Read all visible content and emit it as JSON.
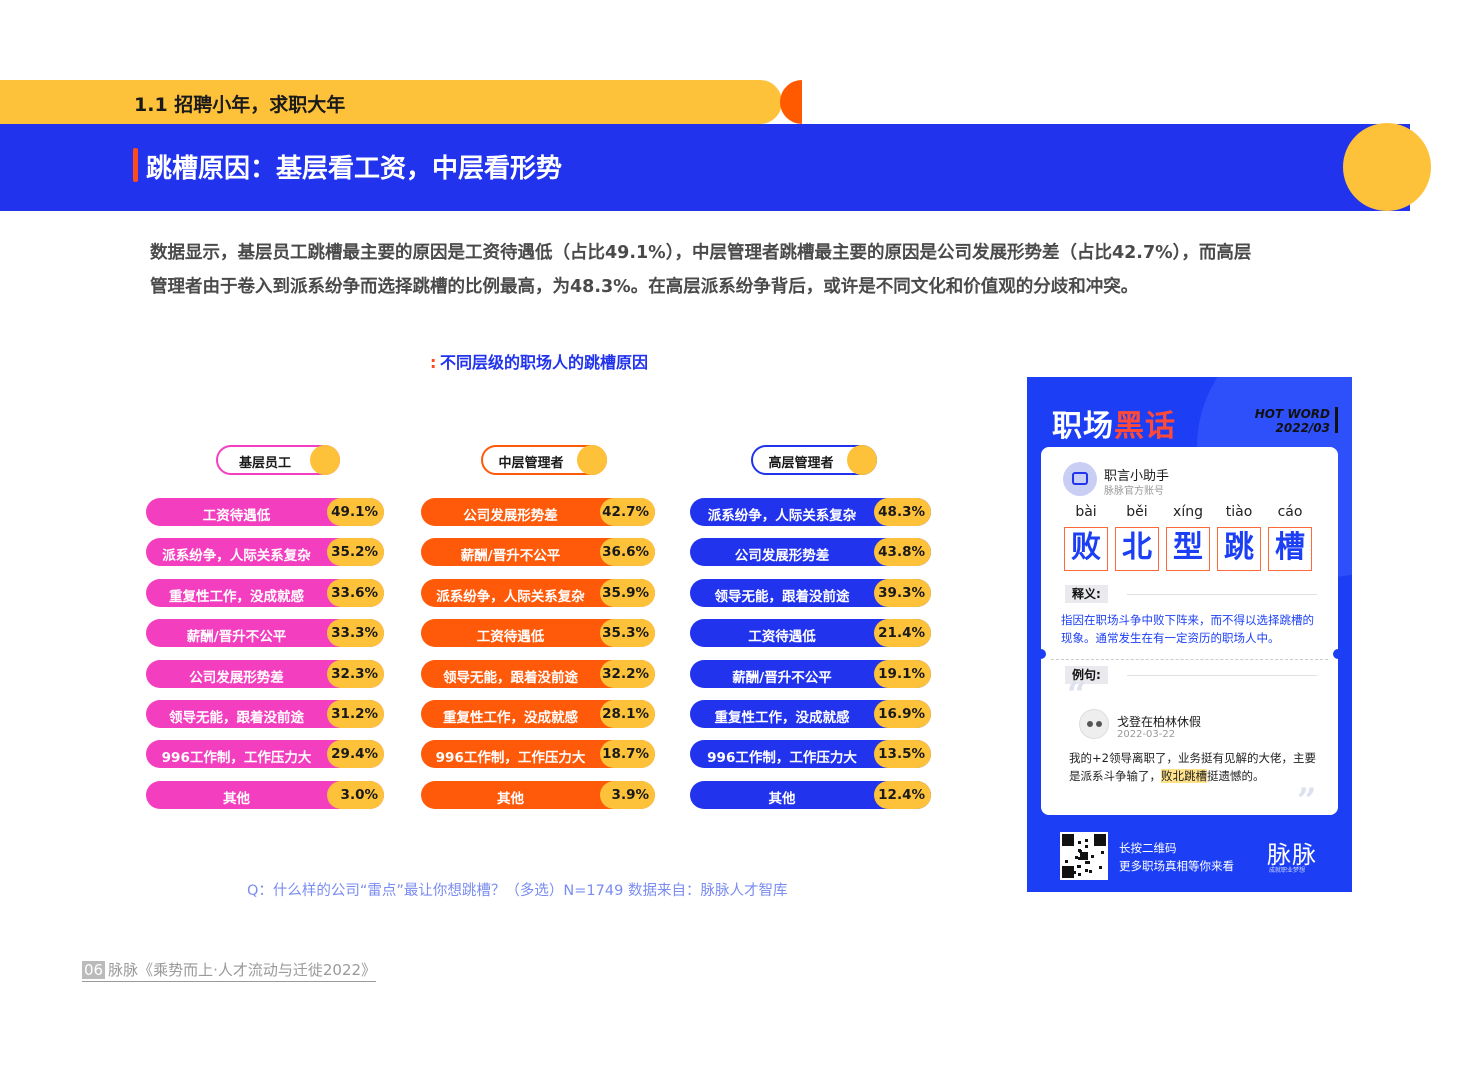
{
  "header": {
    "section": "1.1 招聘小年，求职大年",
    "title": "跳槽原因：基层看工资，中层看形势"
  },
  "intro": {
    "line1": "数据显示，基层员工跳槽最主要的原因是工资待遇低（占比49.1%），中层管理者跳槽最主要的原因是公司发展形势差（占比42.7%），而高层",
    "line2": "管理者由于卷入到派系纷争而选择跳槽的比例最高，为48.3%。在高层派系纷争背后，或许是不同文化和价值观的分歧和冲突。"
  },
  "chart_title": "不同层级的职场人的跳槽原因",
  "colors": {
    "pink": "#F43EC0",
    "orange": "#FF5A0A",
    "blue": "#2233EE",
    "yellow": "#FDC23A"
  },
  "chart_data": [
    {
      "type": "bar",
      "title": "基层员工",
      "categories": [
        "工资待遇低",
        "派系纷争，人际关系复杂",
        "重复性工作，没成就感",
        "薪酬/晋升不公平",
        "公司发展形势差",
        "领导无能，跟着没前途",
        "996工作制，工作压力大",
        "其他"
      ],
      "values": [
        49.1,
        35.2,
        33.6,
        33.3,
        32.3,
        31.2,
        29.4,
        3.0
      ],
      "value_labels": [
        "49.1%",
        "35.2%",
        "33.6%",
        "33.3%",
        "32.3%",
        "31.2%",
        "29.4%",
        "3.0%"
      ],
      "color": "#F43EC0",
      "unit": "%"
    },
    {
      "type": "bar",
      "title": "中层管理者",
      "categories": [
        "公司发展形势差",
        "薪酬/晋升不公平",
        "派系纷争，人际关系复杂",
        "工资待遇低",
        "领导无能，跟着没前途",
        "重复性工作，没成就感",
        "996工作制，工作压力大",
        "其他"
      ],
      "values": [
        42.7,
        36.6,
        35.9,
        35.3,
        32.2,
        28.1,
        18.7,
        3.9
      ],
      "value_labels": [
        "42.7%",
        "36.6%",
        "35.9%",
        "35.3%",
        "32.2%",
        "28.1%",
        "18.7%",
        "3.9%"
      ],
      "color": "#FF5A0A",
      "unit": "%"
    },
    {
      "type": "bar",
      "title": "高层管理者",
      "categories": [
        "派系纷争，人际关系复杂",
        "公司发展形势差",
        "领导无能，跟着没前途",
        "工资待遇低",
        "薪酬/晋升不公平",
        "重复性工作，没成就感",
        "996工作制，工作压力大",
        "其他"
      ],
      "values": [
        48.3,
        43.8,
        39.3,
        21.4,
        19.1,
        16.9,
        13.5,
        12.4
      ],
      "value_labels": [
        "48.3%",
        "43.8%",
        "39.3%",
        "21.4%",
        "19.1%",
        "16.9%",
        "13.5%",
        "12.4%"
      ],
      "color": "#2233EE",
      "unit": "%"
    }
  ],
  "source_note": "Q：什么样的公司“雷点”最让你想跳槽？（多选）N=1749   数据来自：脉脉人才智库",
  "footer": {
    "page": "06",
    "text": "脉脉《乘势而上·人才流动与迁徙2022》"
  },
  "card": {
    "title_a": "职场",
    "title_b": "黑话",
    "hot_word": "HOT WORD",
    "hot_date": "2022/03",
    "account_name": "职言小助手",
    "account_sub": "脉脉官方账号",
    "pinyin": [
      "bài",
      "běi",
      "xíng",
      "tiào",
      "cáo"
    ],
    "chars": [
      "败",
      "北",
      "型",
      "跳",
      "槽"
    ],
    "def_tag": "释义:",
    "definition": "指因在职场斗争中败下阵来，而不得以选择跳槽的现象。通常发生在有一定资历的职场人中。",
    "example_tag": "例句:",
    "user_name": "戈登在柏林休假",
    "user_date": "2022-03-22",
    "comment_pre": "我的+2领导离职了，业务挺有见解的大佬，主要是派系斗争输了，",
    "comment_mark": "败北跳槽",
    "comment_post": "挺遗憾的。",
    "qr_line1": "长按二维码",
    "qr_line2": "更多职场真相等你来看",
    "brand": "脉脉",
    "brand_sub": "成就职业梦想"
  }
}
